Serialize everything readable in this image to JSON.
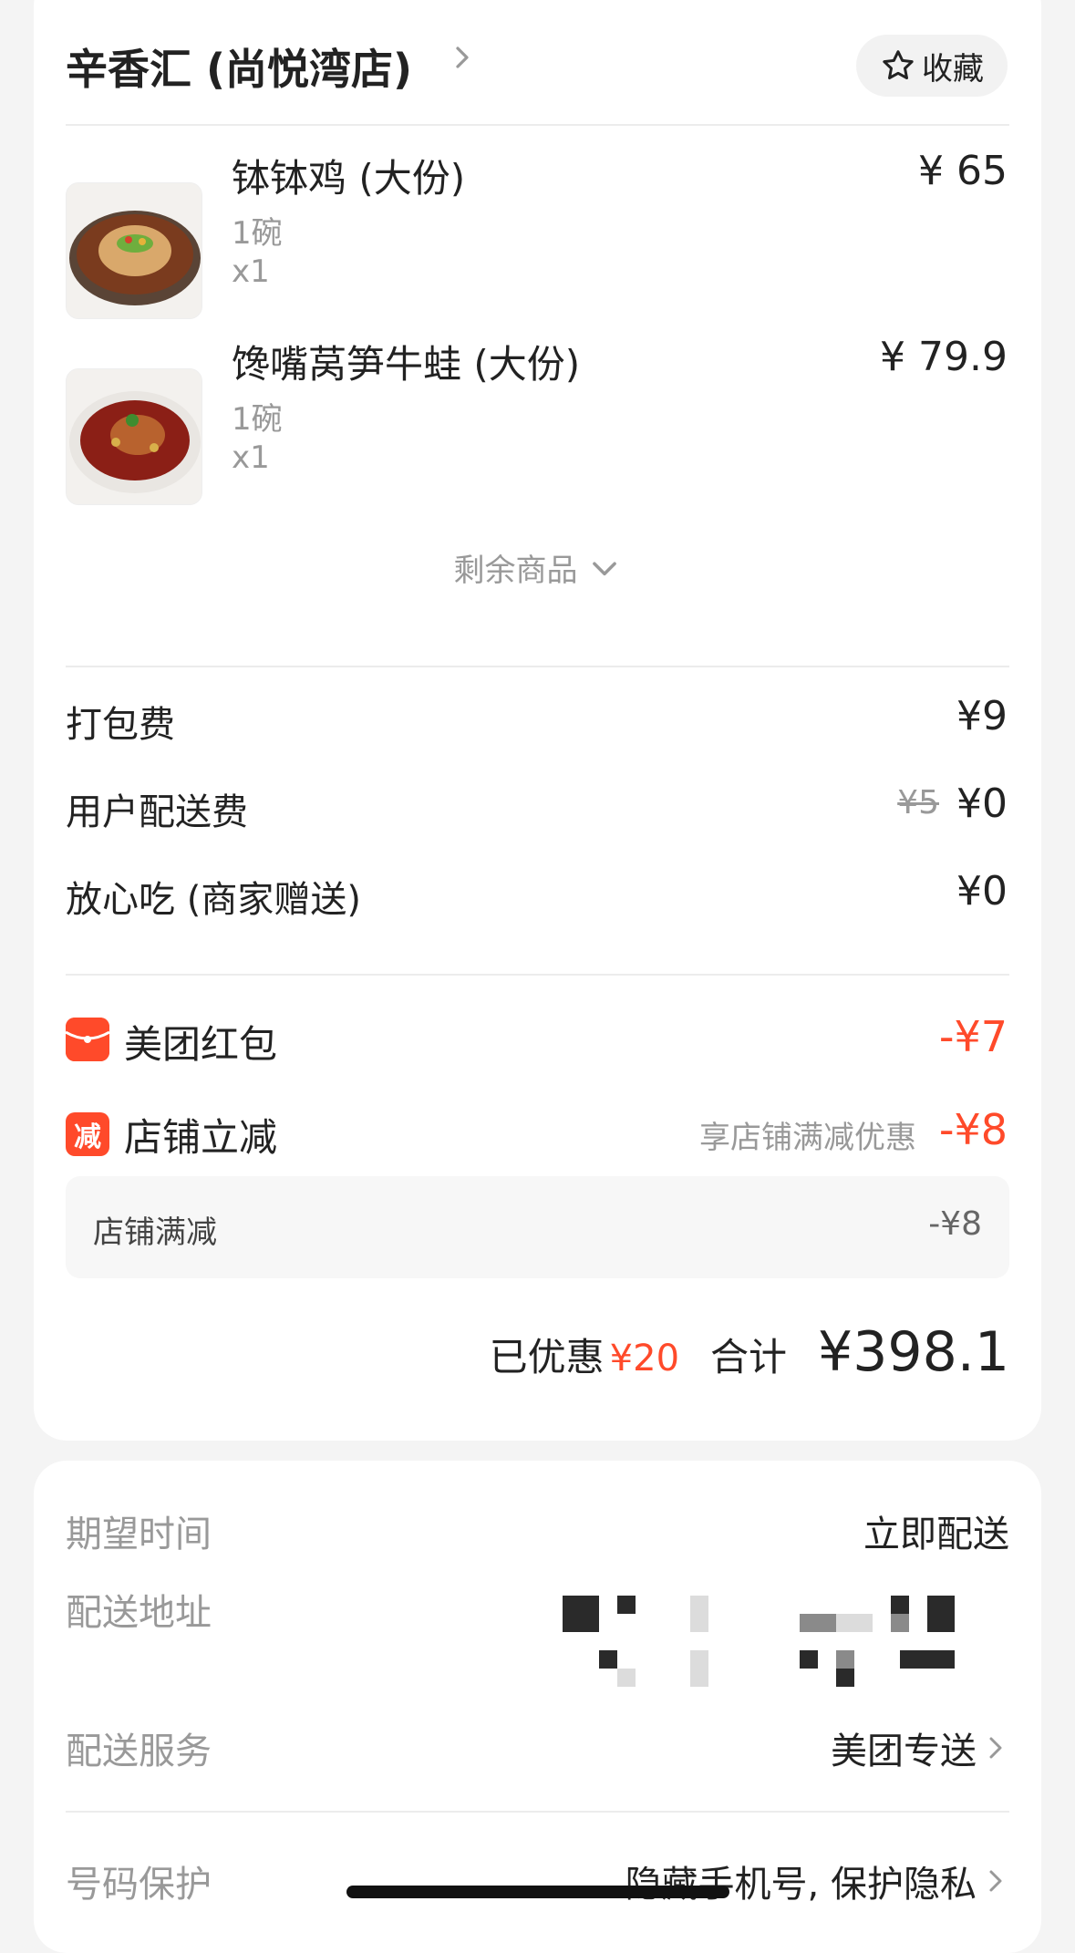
{
  "store": {
    "name": "辛香汇 (尚悦湾店)",
    "favorite_label": "收藏"
  },
  "items": [
    {
      "name": "钵钵鸡 (大份)",
      "spec": "1碗",
      "qty": "x1",
      "price": "¥ 65"
    },
    {
      "name": "馋嘴莴笋牛蛙 (大份)",
      "spec": "1碗",
      "qty": "x1",
      "price": "¥ 79.9"
    }
  ],
  "more_label": "剩余商品",
  "fees": {
    "packing": {
      "label": "打包费",
      "value": "¥9"
    },
    "delivery": {
      "label": "用户配送费",
      "original": "¥5",
      "value": "¥0"
    },
    "assurance": {
      "label": "放心吃 (商家赠送)",
      "value": "¥0"
    }
  },
  "promos": {
    "red_packet": {
      "label": "美团红包",
      "value": "-¥7"
    },
    "store_discount": {
      "icon_text": "减",
      "label": "店铺立减",
      "desc": "享店铺满减优惠",
      "value": "-¥8",
      "detail_label": "店铺满减",
      "detail_value": "-¥8"
    }
  },
  "totals": {
    "saved_label": "已优惠",
    "saved_value": "¥20",
    "sum_label": "合计",
    "sum_value": "¥398.1"
  },
  "delivery_info": {
    "time_label": "期望时间",
    "time_value": "立即配送",
    "address_label": "配送地址",
    "service_label": "配送服务",
    "service_value": "美团专送",
    "phone_label": "号码保护",
    "phone_value": "隐藏手机号, 保护隐私"
  },
  "colors": {
    "accent": "#ff4a2a",
    "muted_text": "#999999",
    "card_bg": "#ffffff",
    "page_bg": "#f4f4f4"
  }
}
